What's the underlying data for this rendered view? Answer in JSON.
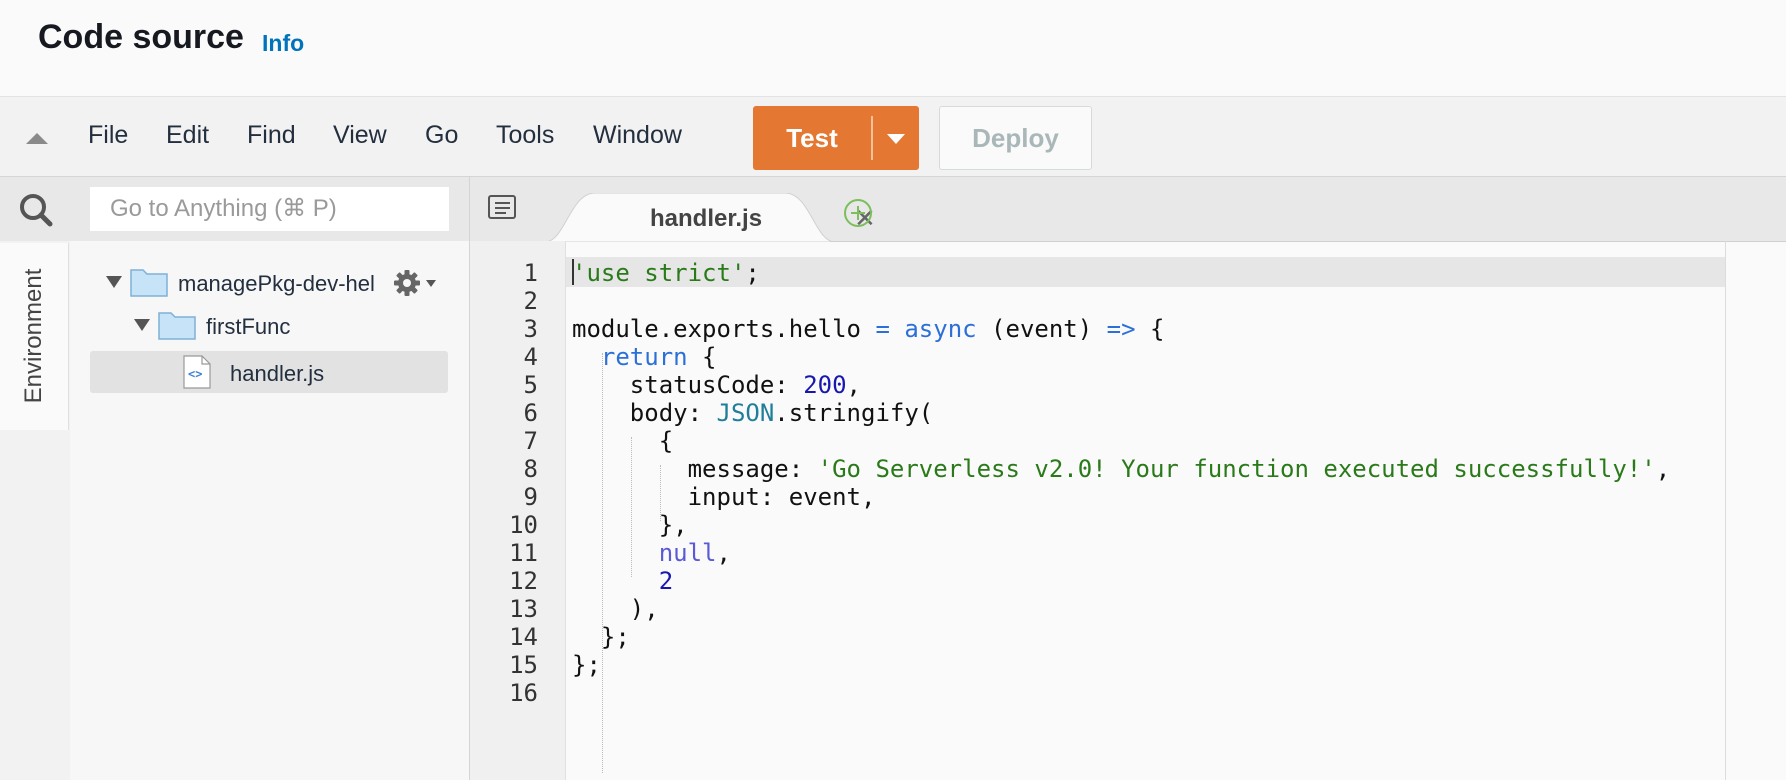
{
  "header": {
    "title": "Code source",
    "info_link": "Info"
  },
  "toolbar": {
    "menu": [
      "File",
      "Edit",
      "Find",
      "View",
      "Go",
      "Tools",
      "Window"
    ],
    "test_label": "Test",
    "deploy_label": "Deploy"
  },
  "sidebar": {
    "search_placeholder": "Go to Anything (⌘ P)",
    "environment_tab": "Environment",
    "tree": {
      "root": "managePkg-dev-hel",
      "folder": "firstFunc",
      "file": "handler.js"
    }
  },
  "editor": {
    "tab_label": "handler.js",
    "line_numbers": [
      "1",
      "2",
      "3",
      "4",
      "5",
      "6",
      "7",
      "8",
      "9",
      "10",
      "11",
      "12",
      "13",
      "14",
      "15",
      "16"
    ],
    "code_lines": [
      "'use strict';",
      "",
      "module.exports.hello = async (event) => {",
      "  return {",
      "    statusCode: 200,",
      "    body: JSON.stringify(",
      "      {",
      "        message: 'Go Serverless v2.0! Your function executed successfully!',",
      "        input: event,",
      "      },",
      "      null,",
      "      2",
      "    ),",
      "  };",
      "};",
      ""
    ]
  },
  "colors": {
    "accent": "#e47832",
    "info_link": "#0073bb",
    "string": "#2a7a1a",
    "keyword": "#2d6fd8"
  }
}
